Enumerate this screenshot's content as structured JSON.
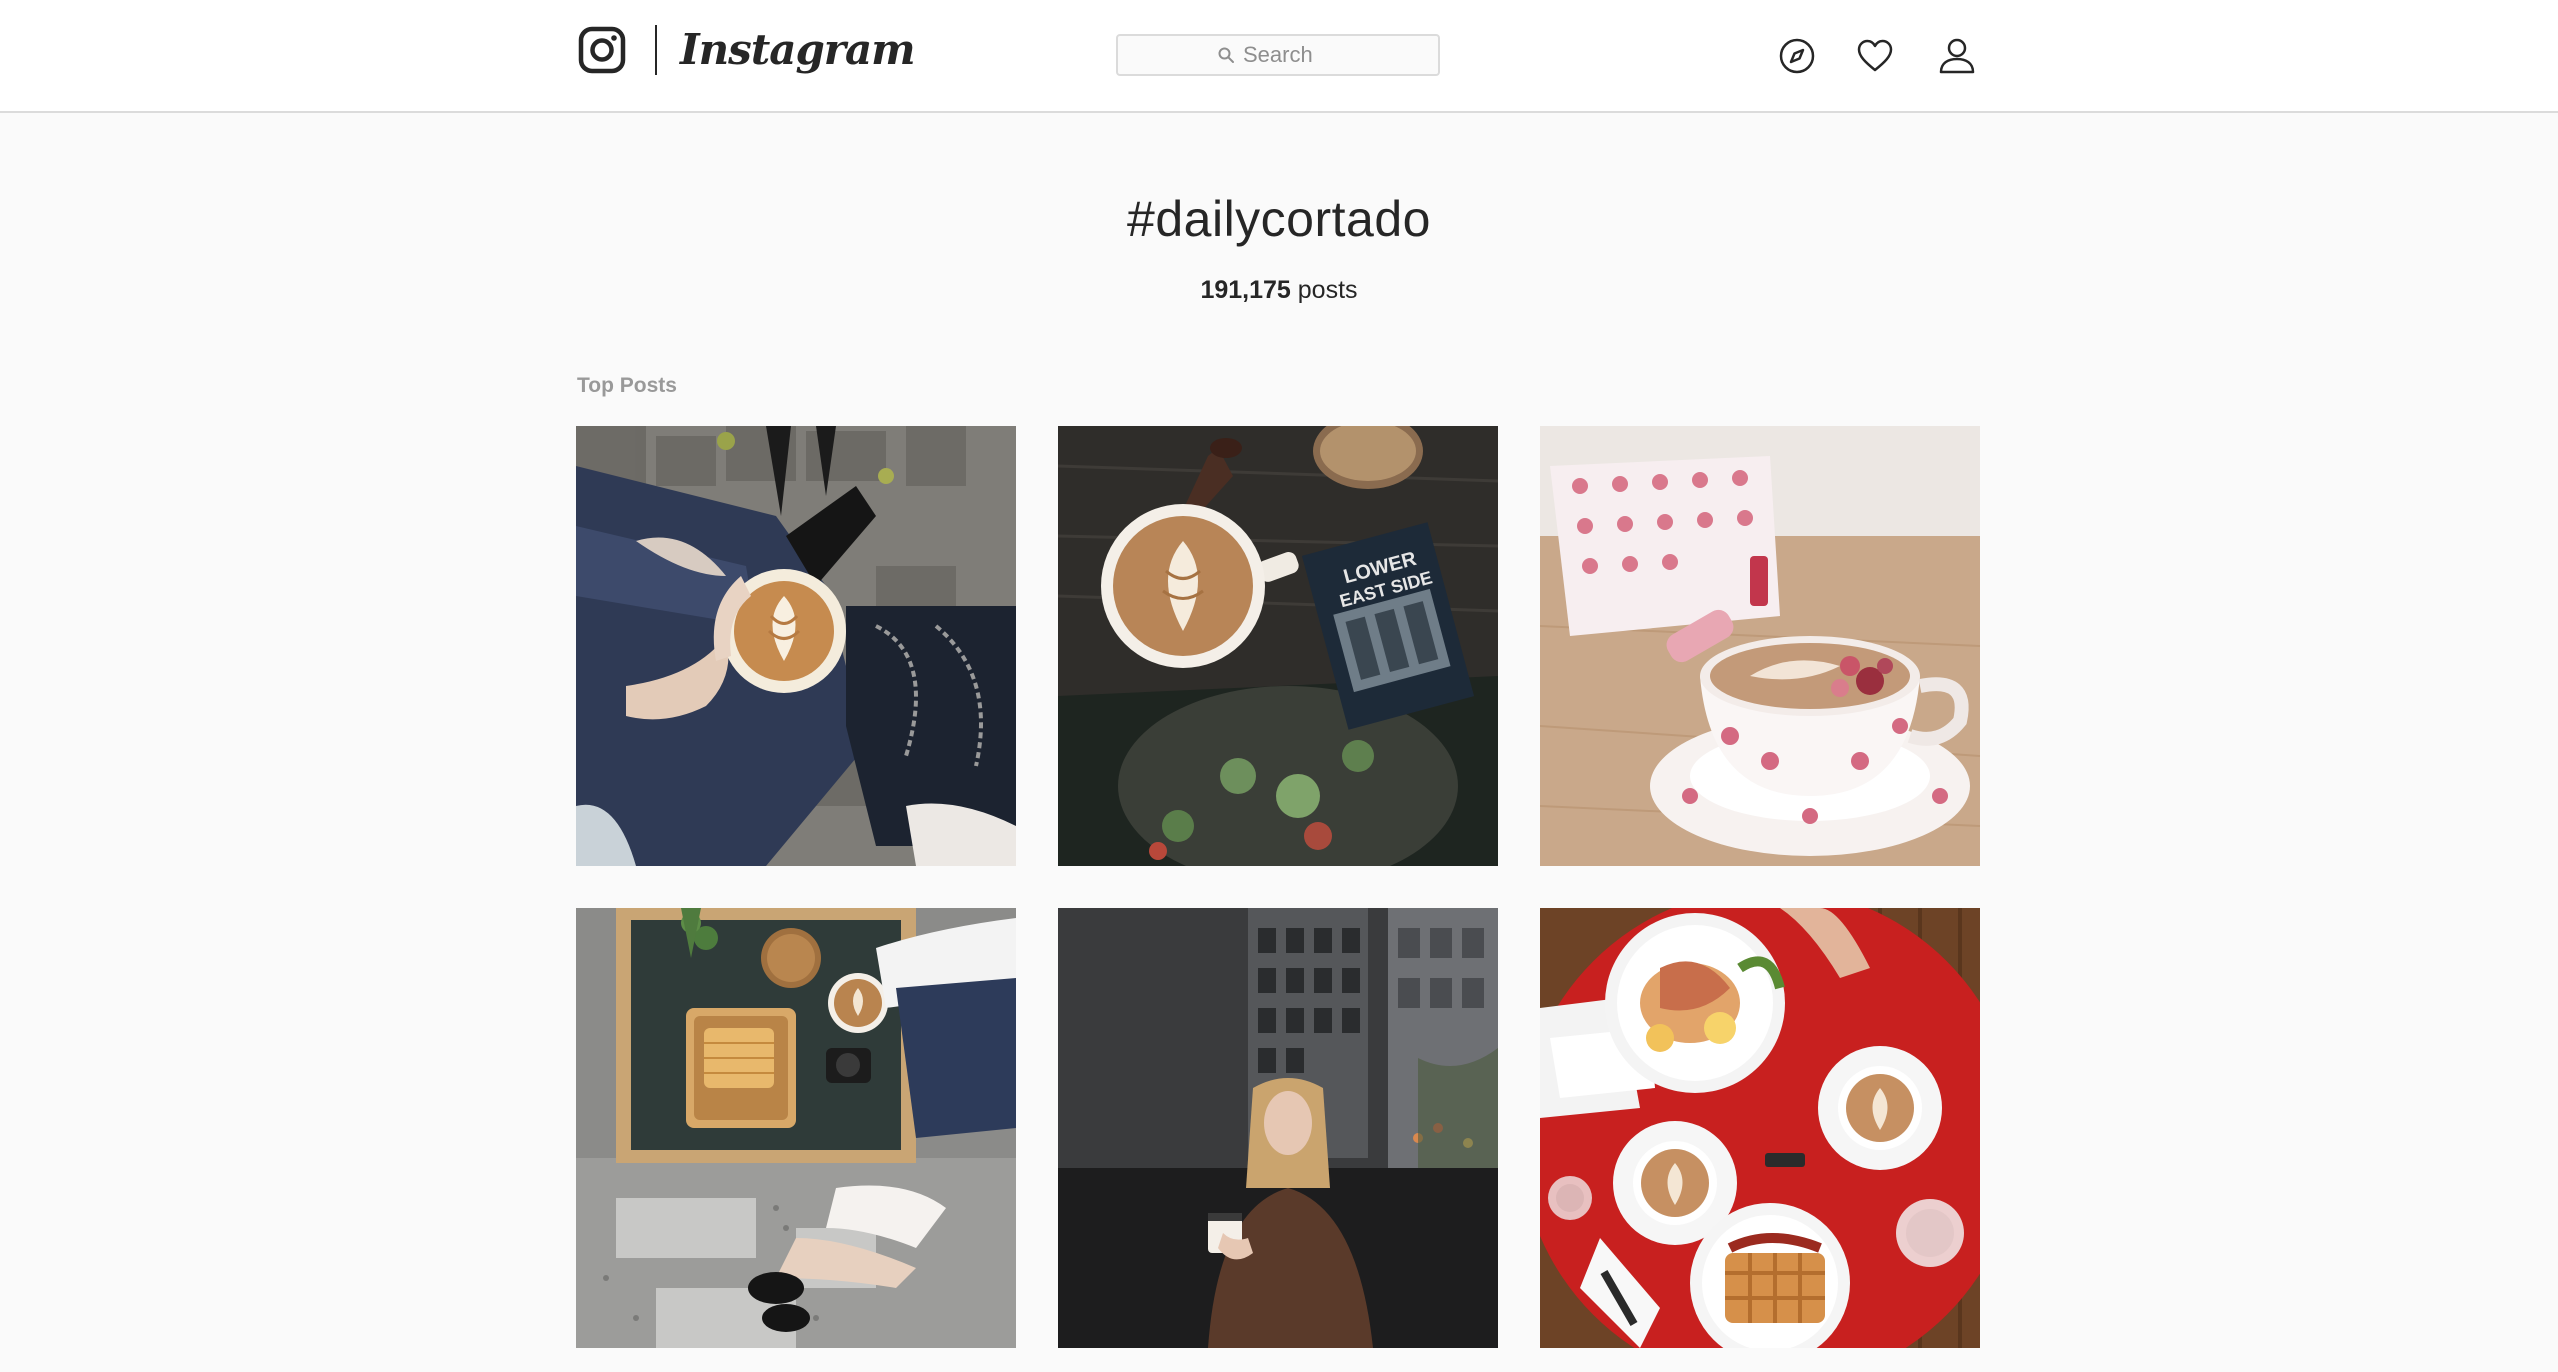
{
  "header": {
    "logo_text": "Instagram",
    "search": {
      "placeholder": "Search",
      "icon": "search-icon"
    },
    "nav": [
      {
        "name": "explore",
        "icon": "compass-icon"
      },
      {
        "name": "activity",
        "icon": "heart-icon"
      },
      {
        "name": "profile",
        "icon": "person-icon"
      }
    ]
  },
  "hashtag": {
    "title": "#dailycortado",
    "post_count": "191,175",
    "post_count_suffix": " posts"
  },
  "section": {
    "label": "Top Posts"
  },
  "posts": [
    {
      "image": "latte art cup held over knee in ripped jeans, stone pavement"
    },
    {
      "image": "latte with spoon and Lower East Side book on dark wood table"
    },
    {
      "image": "floral teacup latte with rose petals and lipstick on wood"
    },
    {
      "image": "tray with toast and cortado, plant and camera on tiled floor"
    },
    {
      "image": "woman holding cup at street window, city buildings behind"
    },
    {
      "image": "red table with brunch plates, waffles and two lattes"
    }
  ],
  "colors": {
    "background": "#fafafa",
    "header_bg": "#ffffff",
    "border": "#dbdbdb",
    "text": "#262626",
    "muted": "#999999"
  }
}
